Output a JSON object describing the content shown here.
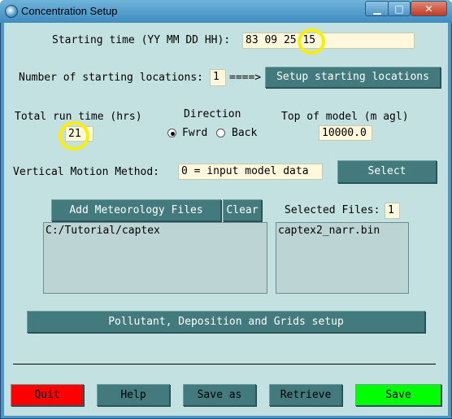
{
  "window": {
    "title": "Concentration Setup",
    "icon": "globe-icon",
    "controls": {
      "minimize": "▁",
      "maximize": "□",
      "close": "✕"
    }
  },
  "start_time": {
    "label": "Starting time (YY MM DD HH):",
    "value": "83 09 25 15"
  },
  "locations": {
    "label": "Number of starting locations:",
    "value": "1",
    "arrow": "====>",
    "setup_button": "Setup starting locations"
  },
  "run_time": {
    "label": "Total run time (hrs)",
    "value": "21"
  },
  "direction": {
    "label": "Direction",
    "options": [
      "Fwrd",
      "Back"
    ],
    "selected": "Fwrd"
  },
  "top_model": {
    "label": "Top of model (m agl)",
    "value": "10000.0"
  },
  "vertical_motion": {
    "label": "Vertical Motion Method:",
    "value": "0 = input model data",
    "select_button": "Select"
  },
  "meteorology": {
    "add_button": "Add Meteorology Files",
    "clear_button": "Clear",
    "directories": [
      "C:/Tutorial/captex"
    ],
    "selected_label": "Selected Files:",
    "selected_count": "1",
    "files": [
      "captex2_narr.bin"
    ]
  },
  "pollutant_button": "Pollutant, Deposition and Grids setup",
  "footer": {
    "quit": "Quit",
    "help": "Help",
    "save_as": "Save as",
    "retrieve": "Retrieve",
    "save": "Save"
  },
  "colors": {
    "background": "#c4e1e1",
    "button": "#427a7e",
    "field": "#fff8dc",
    "quit": "#ff0000",
    "save": "#00ff00",
    "highlight_ring": "#ffee00"
  }
}
